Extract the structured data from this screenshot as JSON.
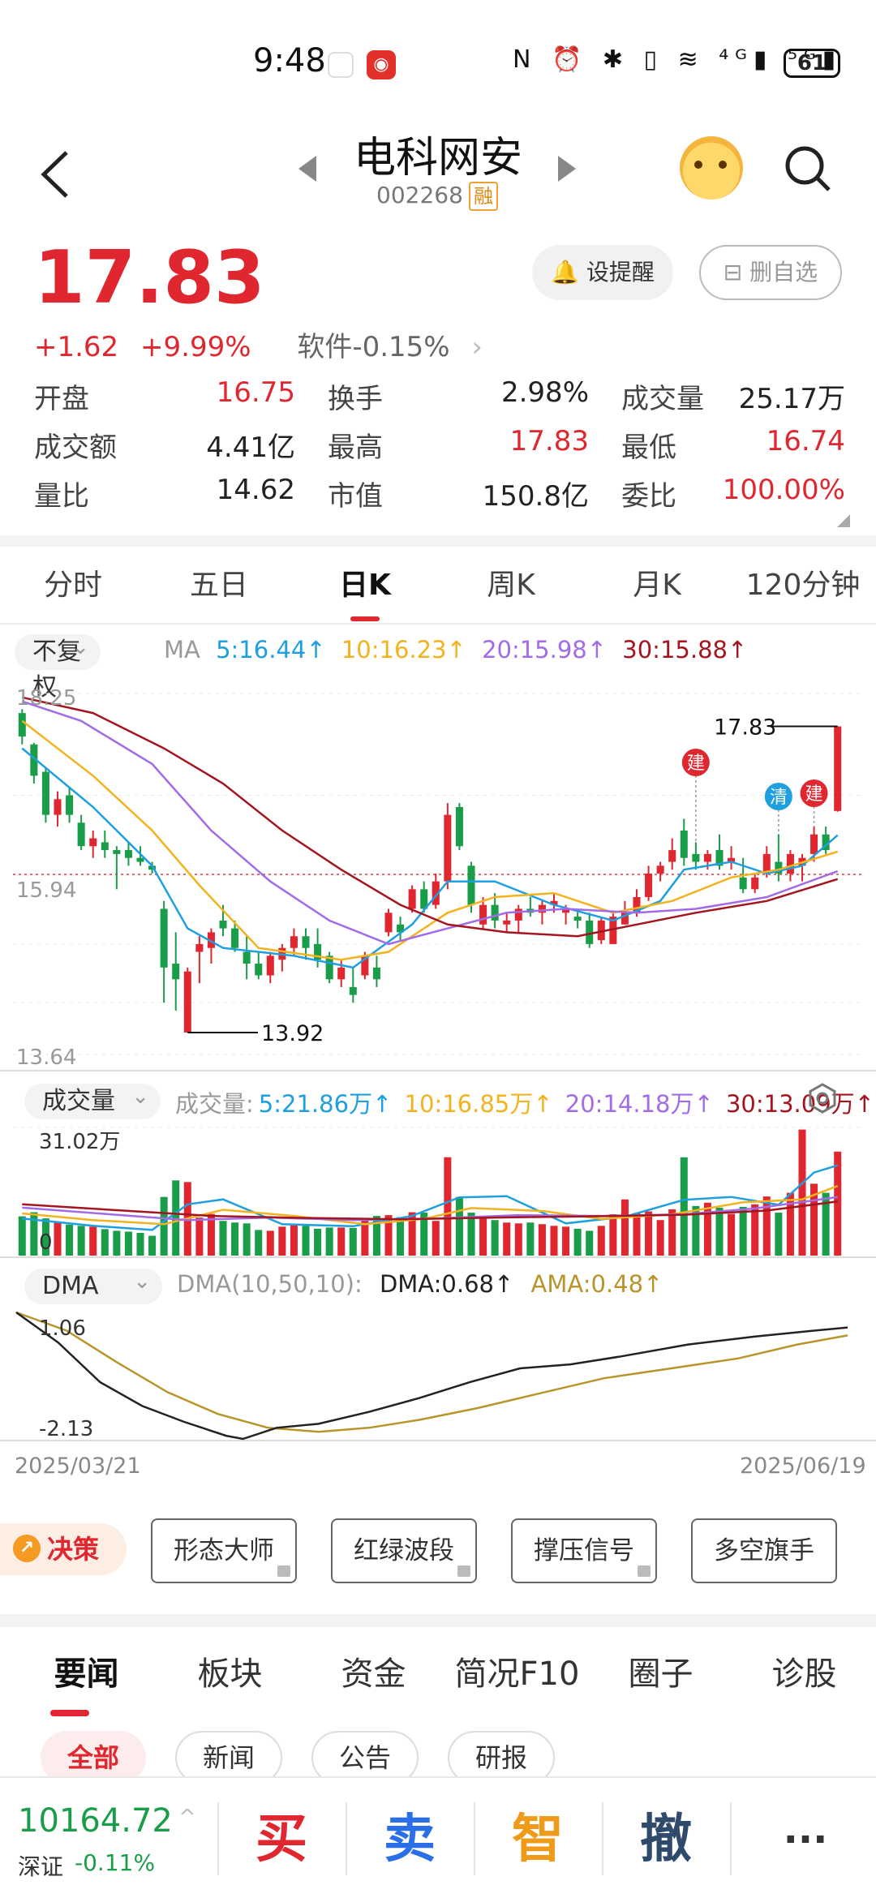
{
  "status_bar": {
    "time": "9:48",
    "icons": "N ⏰ ✱ ▯ ≋ ⁴ᴳ▮ ⁵ᴳ▮",
    "battery": "61"
  },
  "header": {
    "stock_name": "电科网安",
    "stock_code": "002268",
    "margin_badge": "融"
  },
  "quote": {
    "price": "17.83",
    "change": "+1.62",
    "change_pct": "+9.99%",
    "sector": "软件-0.15%",
    "sector_arrow": "›",
    "alert_label": "设提醒",
    "remove_label": "删自选",
    "stats": [
      [
        {
          "label": "开盘",
          "value": "16.75",
          "color": "red"
        },
        {
          "label": "换手",
          "value": "2.98%",
          "color": "normal"
        },
        {
          "label": "成交量",
          "value": "25.17万",
          "color": "normal"
        }
      ],
      [
        {
          "label": "成交额",
          "value": "4.41亿",
          "color": "normal"
        },
        {
          "label": "最高",
          "value": "17.83",
          "color": "red"
        },
        {
          "label": "最低",
          "value": "16.74",
          "color": "red"
        }
      ],
      [
        {
          "label": "量比",
          "value": "14.62",
          "color": "normal"
        },
        {
          "label": "市值",
          "value": "150.8亿",
          "color": "normal"
        },
        {
          "label": "委比",
          "value": "100.00%",
          "color": "red"
        }
      ]
    ]
  },
  "period_tabs": [
    "分时",
    "五日",
    "日K",
    "周K",
    "月K",
    "120分钟"
  ],
  "active_period": "日K",
  "kline": {
    "adjust_label": "不复权",
    "ma_prefix": "MA",
    "ma": [
      {
        "label": "5:16.44↑",
        "color": "#1e9fe0"
      },
      {
        "label": "10:16.23↑",
        "color": "#f2b31f"
      },
      {
        "label": "20:15.98↑",
        "color": "#a26be8"
      },
      {
        "label": "30:15.88↑",
        "color": "#a3151f"
      }
    ],
    "y_top": "18.25",
    "y_mid": "15.94",
    "y_bottom": "13.64",
    "high_label": "17.83",
    "low_label": "13.92",
    "marker_jian": "建",
    "marker_qing": "清"
  },
  "volume": {
    "selector_label": "成交量",
    "prefix": "成交量:",
    "ma": [
      {
        "label": "5:21.86万↑",
        "color": "#1e9fe0"
      },
      {
        "label": "10:16.85万↑",
        "color": "#f2b31f"
      },
      {
        "label": "20:14.18万↑",
        "color": "#a26be8"
      },
      {
        "label": "30:13.09万↑",
        "color": "#a3151f"
      }
    ],
    "y_top": "31.02万",
    "y_zero": "0"
  },
  "dma": {
    "selector_label": "DMA",
    "params": "DMA(10,50,10):",
    "dma_value": "DMA:0.68↑",
    "ama_value": "AMA:0.48↑",
    "y_top": "1.06",
    "y_bottom": "-2.13"
  },
  "dates": {
    "start": "2025/03/21",
    "end": "2025/06/19"
  },
  "decision": {
    "label": "决策",
    "tools": [
      "形态大师",
      "红绿波段",
      "撑压信号",
      "多空旗手"
    ]
  },
  "news_tabs": [
    "要闻",
    "板块",
    "资金",
    "简况F10",
    "圈子",
    "诊股"
  ],
  "news_filters": [
    "全部",
    "新闻",
    "公告",
    "研报"
  ],
  "bottom": {
    "index_value": "10164.72",
    "index_caret": "^",
    "index_name": "深证",
    "index_change": "-0.11%",
    "buy": "买",
    "sell": "卖",
    "smart": "智",
    "cancel": "撤",
    "more": "···"
  },
  "colors": {
    "up": "#e0262f",
    "down": "#1a9d48",
    "ma5": "#1e9fe0",
    "ma10": "#f2b31f",
    "ma20": "#a26be8",
    "ma30": "#a3151f"
  },
  "chart_data": {
    "type": "candlestick",
    "ohlc": [
      [
        18.0,
        18.05,
        17.6,
        17.7
      ],
      [
        17.6,
        17.62,
        17.1,
        17.2
      ],
      [
        17.25,
        17.3,
        16.6,
        16.7
      ],
      [
        16.7,
        17.0,
        16.55,
        16.9
      ],
      [
        16.95,
        17.05,
        16.6,
        16.7
      ],
      [
        16.6,
        16.7,
        16.25,
        16.3
      ],
      [
        16.3,
        16.5,
        16.15,
        16.4
      ],
      [
        16.35,
        16.5,
        16.15,
        16.25
      ],
      [
        16.25,
        16.3,
        15.75,
        16.2
      ],
      [
        16.25,
        16.35,
        16.05,
        16.15
      ],
      [
        16.15,
        16.3,
        16.05,
        16.1
      ],
      [
        16.05,
        16.1,
        15.95,
        16.0
      ],
      [
        15.5,
        15.6,
        14.3,
        14.75
      ],
      [
        14.8,
        15.2,
        14.2,
        14.6
      ],
      [
        13.92,
        14.75,
        13.92,
        14.7
      ],
      [
        14.95,
        15.15,
        14.55,
        15.05
      ],
      [
        15.0,
        15.25,
        14.8,
        15.2
      ],
      [
        15.35,
        15.55,
        15.15,
        15.25
      ],
      [
        15.25,
        15.35,
        14.95,
        15.0
      ],
      [
        14.95,
        15.15,
        14.6,
        14.8
      ],
      [
        14.8,
        14.95,
        14.6,
        14.65
      ],
      [
        14.65,
        14.95,
        14.55,
        14.9
      ],
      [
        14.85,
        15.05,
        14.7,
        15.0
      ],
      [
        15.0,
        15.25,
        14.9,
        15.15
      ],
      [
        15.15,
        15.25,
        14.85,
        15.0
      ],
      [
        15.05,
        15.25,
        14.75,
        14.85
      ],
      [
        14.9,
        14.95,
        14.55,
        14.6
      ],
      [
        14.6,
        14.85,
        14.5,
        14.75
      ],
      [
        14.5,
        14.75,
        14.3,
        14.4
      ],
      [
        14.65,
        14.95,
        14.6,
        14.9
      ],
      [
        14.75,
        14.9,
        14.5,
        14.6
      ],
      [
        15.2,
        15.5,
        15.15,
        15.45
      ],
      [
        15.3,
        15.4,
        15.1,
        15.2
      ],
      [
        15.5,
        15.8,
        15.45,
        15.75
      ],
      [
        15.75,
        15.85,
        15.45,
        15.5
      ],
      [
        15.55,
        15.95,
        15.5,
        15.85
      ],
      [
        15.85,
        16.85,
        15.75,
        16.7
      ],
      [
        16.8,
        16.85,
        16.25,
        16.3
      ],
      [
        16.05,
        16.1,
        15.45,
        15.55
      ],
      [
        15.3,
        15.65,
        15.25,
        15.55
      ],
      [
        15.55,
        15.7,
        15.25,
        15.35
      ],
      [
        15.3,
        15.45,
        15.2,
        15.35
      ],
      [
        15.35,
        15.55,
        15.2,
        15.5
      ],
      [
        15.5,
        15.65,
        15.4,
        15.45
      ],
      [
        15.45,
        15.6,
        15.3,
        15.55
      ],
      [
        15.55,
        15.7,
        15.45,
        15.6
      ],
      [
        15.45,
        15.55,
        15.3,
        15.5
      ],
      [
        15.4,
        15.5,
        15.25,
        15.35
      ],
      [
        15.35,
        15.45,
        15.0,
        15.05
      ],
      [
        15.1,
        15.4,
        15.05,
        15.35
      ],
      [
        15.05,
        15.45,
        15.05,
        15.4
      ],
      [
        15.3,
        15.6,
        15.3,
        15.45
      ],
      [
        15.45,
        15.75,
        15.4,
        15.65
      ],
      [
        15.65,
        16.05,
        15.6,
        15.95
      ],
      [
        15.95,
        16.1,
        15.85,
        16.05
      ],
      [
        16.1,
        16.4,
        16.0,
        16.25
      ],
      [
        16.5,
        16.65,
        16.05,
        16.15
      ],
      [
        16.2,
        16.35,
        16.0,
        16.1
      ],
      [
        16.1,
        16.25,
        16.0,
        16.2
      ],
      [
        16.25,
        16.45,
        16.0,
        16.05
      ],
      [
        16.1,
        16.3,
        16.0,
        16.15
      ],
      [
        15.9,
        16.15,
        15.7,
        15.75
      ],
      [
        15.75,
        15.95,
        15.7,
        15.9
      ],
      [
        15.95,
        16.3,
        15.9,
        16.2
      ],
      [
        16.1,
        16.45,
        15.85,
        15.95
      ],
      [
        15.95,
        16.25,
        15.85,
        16.2
      ],
      [
        16.05,
        16.2,
        15.85,
        16.15
      ],
      [
        16.2,
        16.55,
        16.1,
        16.45
      ],
      [
        16.45,
        16.55,
        16.2,
        16.25
      ],
      [
        16.75,
        17.83,
        16.74,
        17.83
      ]
    ],
    "volume": [
      9.5,
      10.5,
      9.0,
      8.0,
      7.5,
      7.2,
      7.0,
      6.4,
      6.0,
      5.8,
      5.5,
      4.8,
      14.2,
      18.2,
      17.8,
      9.2,
      10.1,
      8.4,
      8.0,
      7.8,
      6.2,
      6.0,
      7.0,
      7.3,
      7.2,
      6.5,
      6.8,
      6.8,
      6.7,
      8.6,
      9.6,
      9.8,
      9.3,
      10.5,
      10.4,
      8.4,
      23.8,
      14.2,
      10.4,
      9.5,
      8.6,
      8.0,
      7.8,
      8.0,
      7.6,
      7.2,
      7.0,
      6.5,
      6.0,
      7.2,
      10.0,
      13.6,
      10.3,
      10.7,
      8.6,
      11.2,
      23.8,
      12.0,
      12.8,
      11.6,
      10.1,
      11.8,
      12.4,
      14.3,
      10.4,
      15.2,
      30.5,
      17.4,
      15.2,
      25.17
    ],
    "ma_lines": [
      {
        "name": "MA5",
        "points": [
          [
            0,
            17.55
          ],
          [
            6,
            16.8
          ],
          [
            11,
            16.05
          ],
          [
            14,
            15.25
          ],
          [
            17,
            15.0
          ],
          [
            23,
            14.9
          ],
          [
            28,
            14.75
          ],
          [
            33,
            15.3
          ],
          [
            36,
            15.85
          ],
          [
            40,
            15.85
          ],
          [
            45,
            15.55
          ],
          [
            50,
            15.35
          ],
          [
            54,
            15.6
          ],
          [
            56,
            16.0
          ],
          [
            60,
            16.1
          ],
          [
            63,
            15.95
          ],
          [
            66,
            16.05
          ],
          [
            69,
            16.44
          ]
        ]
      },
      {
        "name": "MA10",
        "points": [
          [
            0,
            17.9
          ],
          [
            6,
            17.2
          ],
          [
            11,
            16.5
          ],
          [
            15,
            15.8
          ],
          [
            20,
            15.0
          ],
          [
            27,
            14.85
          ],
          [
            31,
            14.95
          ],
          [
            36,
            15.45
          ],
          [
            40,
            15.65
          ],
          [
            45,
            15.7
          ],
          [
            50,
            15.45
          ],
          [
            55,
            15.6
          ],
          [
            60,
            15.9
          ],
          [
            64,
            16.0
          ],
          [
            69,
            16.23
          ]
        ]
      },
      {
        "name": "MA20",
        "points": [
          [
            0,
            18.15
          ],
          [
            5,
            17.9
          ],
          [
            11,
            17.35
          ],
          [
            16,
            16.5
          ],
          [
            21,
            15.85
          ],
          [
            26,
            15.35
          ],
          [
            31,
            15.05
          ],
          [
            36,
            15.25
          ],
          [
            41,
            15.45
          ],
          [
            46,
            15.5
          ],
          [
            52,
            15.45
          ],
          [
            57,
            15.5
          ],
          [
            63,
            15.65
          ],
          [
            69,
            15.98
          ]
        ]
      },
      {
        "name": "MA30",
        "points": [
          [
            0,
            18.2
          ],
          [
            6,
            18.0
          ],
          [
            12,
            17.55
          ],
          [
            17,
            17.1
          ],
          [
            22,
            16.5
          ],
          [
            27,
            16.0
          ],
          [
            32,
            15.55
          ],
          [
            36,
            15.3
          ],
          [
            41,
            15.2
          ],
          [
            47,
            15.15
          ],
          [
            52,
            15.3
          ],
          [
            57,
            15.45
          ],
          [
            63,
            15.6
          ],
          [
            69,
            15.88
          ]
        ]
      }
    ],
    "vol_ma_lines": [
      {
        "name": "VOL MA5",
        "points": [
          [
            0,
            9.0
          ],
          [
            6,
            7.2
          ],
          [
            11,
            6.2
          ],
          [
            14,
            12.4
          ],
          [
            17,
            13.6
          ],
          [
            22,
            7.6
          ],
          [
            28,
            7.1
          ],
          [
            33,
            9.6
          ],
          [
            37,
            14.1
          ],
          [
            41,
            14.4
          ],
          [
            46,
            7.8
          ],
          [
            51,
            9.4
          ],
          [
            56,
            13.5
          ],
          [
            60,
            14.2
          ],
          [
            64,
            12.3
          ],
          [
            67,
            20.1
          ],
          [
            69,
            21.86
          ]
        ]
      },
      {
        "name": "VOL MA10",
        "points": [
          [
            0,
            10.2
          ],
          [
            6,
            8.6
          ],
          [
            12,
            7.6
          ],
          [
            17,
            11.1
          ],
          [
            23,
            9.6
          ],
          [
            29,
            7.6
          ],
          [
            34,
            8.9
          ],
          [
            38,
            11.5
          ],
          [
            44,
            10.8
          ],
          [
            49,
            8.9
          ],
          [
            55,
            10.0
          ],
          [
            61,
            12.9
          ],
          [
            66,
            13.6
          ],
          [
            69,
            16.85
          ]
        ]
      },
      {
        "name": "VOL MA20",
        "points": [
          [
            0,
            11.6
          ],
          [
            7,
            10.1
          ],
          [
            14,
            8.6
          ],
          [
            21,
            9.2
          ],
          [
            28,
            8.6
          ],
          [
            35,
            9.0
          ],
          [
            42,
            9.8
          ],
          [
            49,
            9.6
          ],
          [
            56,
            10.0
          ],
          [
            62,
            11.4
          ],
          [
            69,
            14.18
          ]
        ]
      },
      {
        "name": "VOL MA30",
        "points": [
          [
            0,
            12.4
          ],
          [
            8,
            11.0
          ],
          [
            16,
            9.6
          ],
          [
            24,
            9.1
          ],
          [
            32,
            8.8
          ],
          [
            40,
            9.2
          ],
          [
            48,
            9.5
          ],
          [
            56,
            9.9
          ],
          [
            63,
            10.9
          ],
          [
            69,
            13.09
          ]
        ]
      }
    ],
    "dma_lines": [
      {
        "name": "DMA",
        "points": [
          [
            0,
            1.06
          ],
          [
            5,
            0.3
          ],
          [
            10,
            -0.7
          ],
          [
            15,
            -1.3
          ],
          [
            20,
            -1.7
          ],
          [
            25,
            -2.05
          ],
          [
            27,
            -2.13
          ],
          [
            31,
            -1.85
          ],
          [
            36,
            -1.75
          ],
          [
            42,
            -1.45
          ],
          [
            48,
            -1.1
          ],
          [
            54,
            -0.7
          ],
          [
            60,
            -0.35
          ],
          [
            66,
            -0.25
          ],
          [
            72,
            -0.05
          ],
          [
            80,
            0.25
          ],
          [
            88,
            0.45
          ],
          [
            95,
            0.6
          ],
          [
            99,
            0.68
          ]
        ]
      },
      {
        "name": "AMA",
        "points": [
          [
            0,
            1.06
          ],
          [
            6,
            0.6
          ],
          [
            12,
            -0.2
          ],
          [
            18,
            -0.95
          ],
          [
            24,
            -1.5
          ],
          [
            30,
            -1.85
          ],
          [
            36,
            -1.95
          ],
          [
            42,
            -1.85
          ],
          [
            48,
            -1.65
          ],
          [
            55,
            -1.35
          ],
          [
            62,
            -1.0
          ],
          [
            70,
            -0.6
          ],
          [
            78,
            -0.35
          ],
          [
            86,
            -0.1
          ],
          [
            93,
            0.25
          ],
          [
            99,
            0.48
          ]
        ]
      }
    ],
    "ylim": [
      13.64,
      18.25
    ],
    "vol_ylim": [
      0,
      31.02
    ],
    "dma_ylim": [
      -2.13,
      1.06
    ],
    "markers": [
      {
        "index": 57,
        "label": "建",
        "color": "#e0262f"
      },
      {
        "index": 64,
        "label": "清",
        "color": "#1e9fe0"
      },
      {
        "index": 67,
        "label": "建",
        "color": "#e0262f"
      }
    ],
    "ref_price": 15.94
  }
}
